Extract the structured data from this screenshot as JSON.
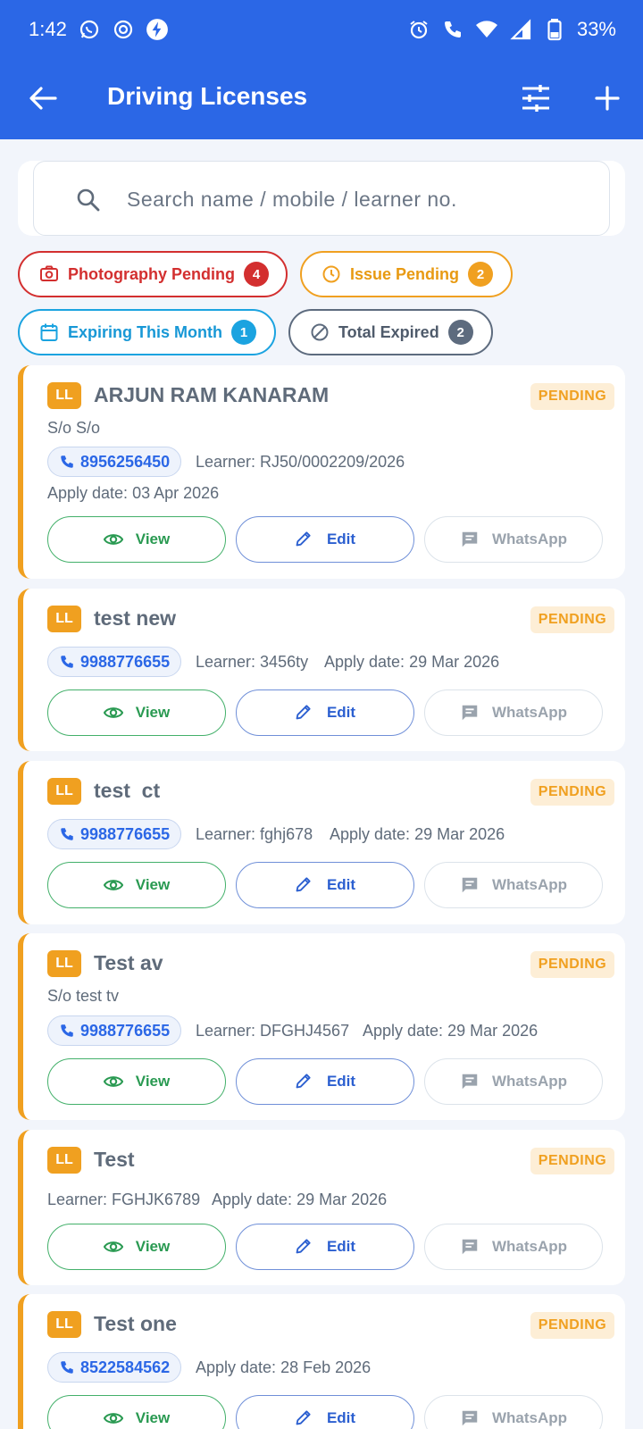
{
  "status_bar": {
    "time": "1:42",
    "battery": "33%",
    "icons": [
      "whatsapp-icon",
      "instagram-icon",
      "bolt-icon",
      "alarm-icon",
      "wifi-call-icon",
      "wifi-icon",
      "signal-icon",
      "battery-icon"
    ]
  },
  "appbar": {
    "title": "Driving Licenses",
    "icons": [
      "back-arrow-icon",
      "tune-icon",
      "plus-icon"
    ]
  },
  "search": {
    "placeholder": "Search name / mobile / learner no."
  },
  "filters": [
    {
      "label": "Photography Pending",
      "count": "4",
      "icon": "camera-icon",
      "color": "#d32f2f"
    },
    {
      "label": "Issue Pending",
      "count": "2",
      "icon": "clock-icon",
      "color": "#f0a020"
    },
    {
      "label": "Expiring This Month",
      "count": "1",
      "icon": "calendar-icon",
      "color": "#1ba3e0"
    },
    {
      "label": "Total Expired",
      "count": "2",
      "icon": "block-icon",
      "color": "#5d6b7e"
    }
  ],
  "colors": {
    "primary": "#2b67e6",
    "pending": "#f0a020",
    "view": "#2a9a52",
    "edit": "#2b5fd0"
  },
  "buttons": {
    "view": "View",
    "edit": "Edit",
    "whatsapp": "WhatsApp"
  },
  "records": [
    {
      "badge": "LL",
      "name": "ARJUN RAM KANARAM",
      "status": "PENDING",
      "relation": "S/o S/o",
      "phone": "8956256450",
      "learner": "Learner: RJ50/0002209/2026",
      "apply": "Apply date: 03 Apr 2026"
    },
    {
      "badge": "LL",
      "name": "test new",
      "status": "PENDING",
      "phone": "9988776655",
      "learner": "Learner: 3456ty",
      "apply": "Apply date: 29 Mar 2026"
    },
    {
      "badge": "LL",
      "name": "test  ct",
      "status": "PENDING",
      "phone": "9988776655",
      "learner": "Learner: fghj678",
      "apply": "Apply date: 29 Mar 2026"
    },
    {
      "badge": "LL",
      "name": "Test av",
      "status": "PENDING",
      "relation": "S/o test tv",
      "phone": "9988776655",
      "learner": "Learner: DFGHJ4567",
      "apply": "Apply date: 29 Mar 2026"
    },
    {
      "badge": "LL",
      "name": "Test",
      "status": "PENDING",
      "learner": "Learner: FGHJK6789",
      "apply": "Apply date: 29 Mar 2026"
    },
    {
      "badge": "LL",
      "name": "Test one",
      "status": "PENDING",
      "phone": "8522584562",
      "apply": "Apply date: 28 Feb 2026"
    }
  ]
}
